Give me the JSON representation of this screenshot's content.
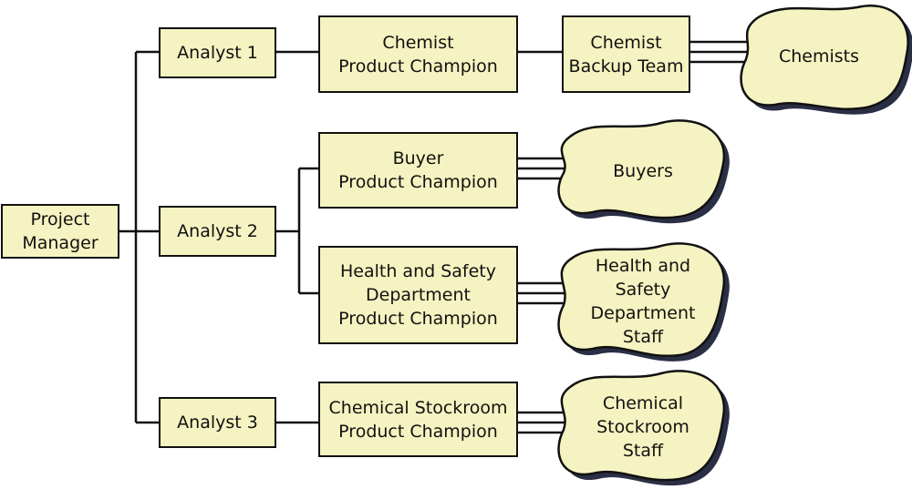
{
  "diagram": {
    "colors": {
      "box_fill": "#f5f3c1",
      "stroke": "#111111",
      "shadow": "#2b2f45"
    },
    "nodes": {
      "project_manager": "Project\nManager",
      "analyst1": "Analyst 1",
      "analyst2": "Analyst 2",
      "analyst3": "Analyst 3",
      "chemist_champion": "Chemist\nProduct Champion",
      "chemist_backup": "Chemist\nBackup Team",
      "buyer_champion": "Buyer\nProduct Champion",
      "hs_champion": "Health and Safety\nDepartment\nProduct Champion",
      "stockroom_champion": "Chemical Stockroom\nProduct Champion"
    },
    "groups": {
      "chemists": "Chemists",
      "buyers": "Buyers",
      "hs_staff": "Health and\nSafety\nDepartment\nStaff",
      "stockroom_staff": "Chemical\nStockroom\nStaff"
    }
  }
}
